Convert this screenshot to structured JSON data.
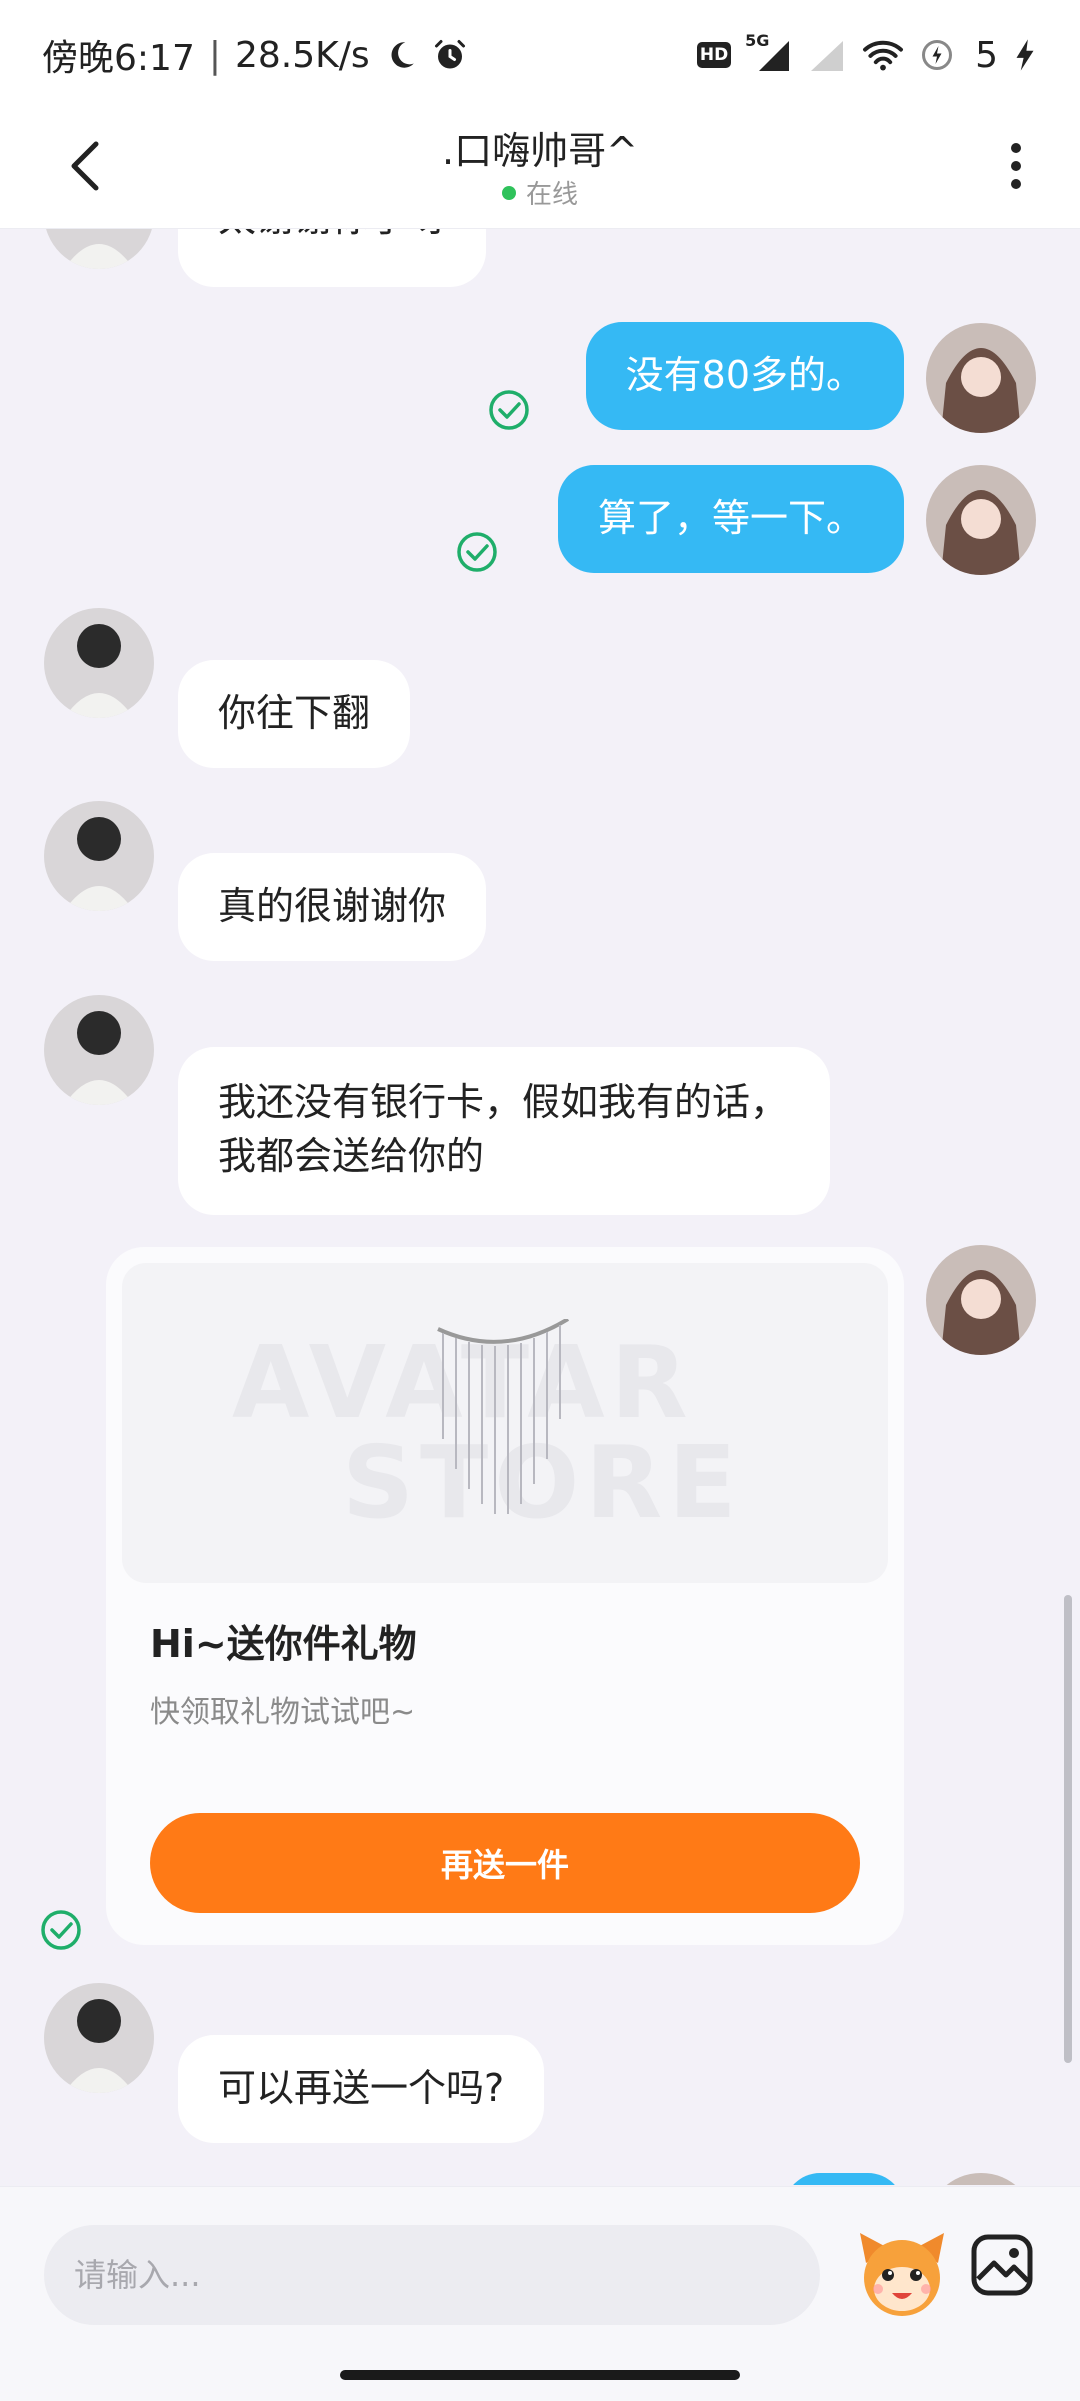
{
  "status_bar": {
    "time": "傍晚6:17",
    "net_speed": "28.5K/s",
    "battery": "5",
    "hd": "HD",
    "net_type": "5G"
  },
  "header": {
    "title": ".口嗨帅哥^",
    "status": "在线"
  },
  "messages": [
    {
      "text": "太谢谢你了呀"
    },
    {
      "text": "没有80多的。"
    },
    {
      "text": "算了，等一下。"
    },
    {
      "text": "你往下翻"
    },
    {
      "text": "真的很谢谢你"
    },
    {
      "text": "我还没有银行卡，假如我有的话，我都会送给你的"
    },
    {
      "text": "可以再送一个吗?"
    }
  ],
  "gift_card": {
    "watermark_line1": "AVATAR",
    "watermark_line2": "STORE",
    "title": "Hi~送你件礼物",
    "subtitle": "快领取礼物试试吧~",
    "button_label": "再送一件"
  },
  "input": {
    "placeholder": "请输入..."
  },
  "colors": {
    "outgoing_bubble": "#35b9f4",
    "gift_button": "#ff7a16",
    "online": "#2fc25b",
    "check": "#1fae6a"
  }
}
